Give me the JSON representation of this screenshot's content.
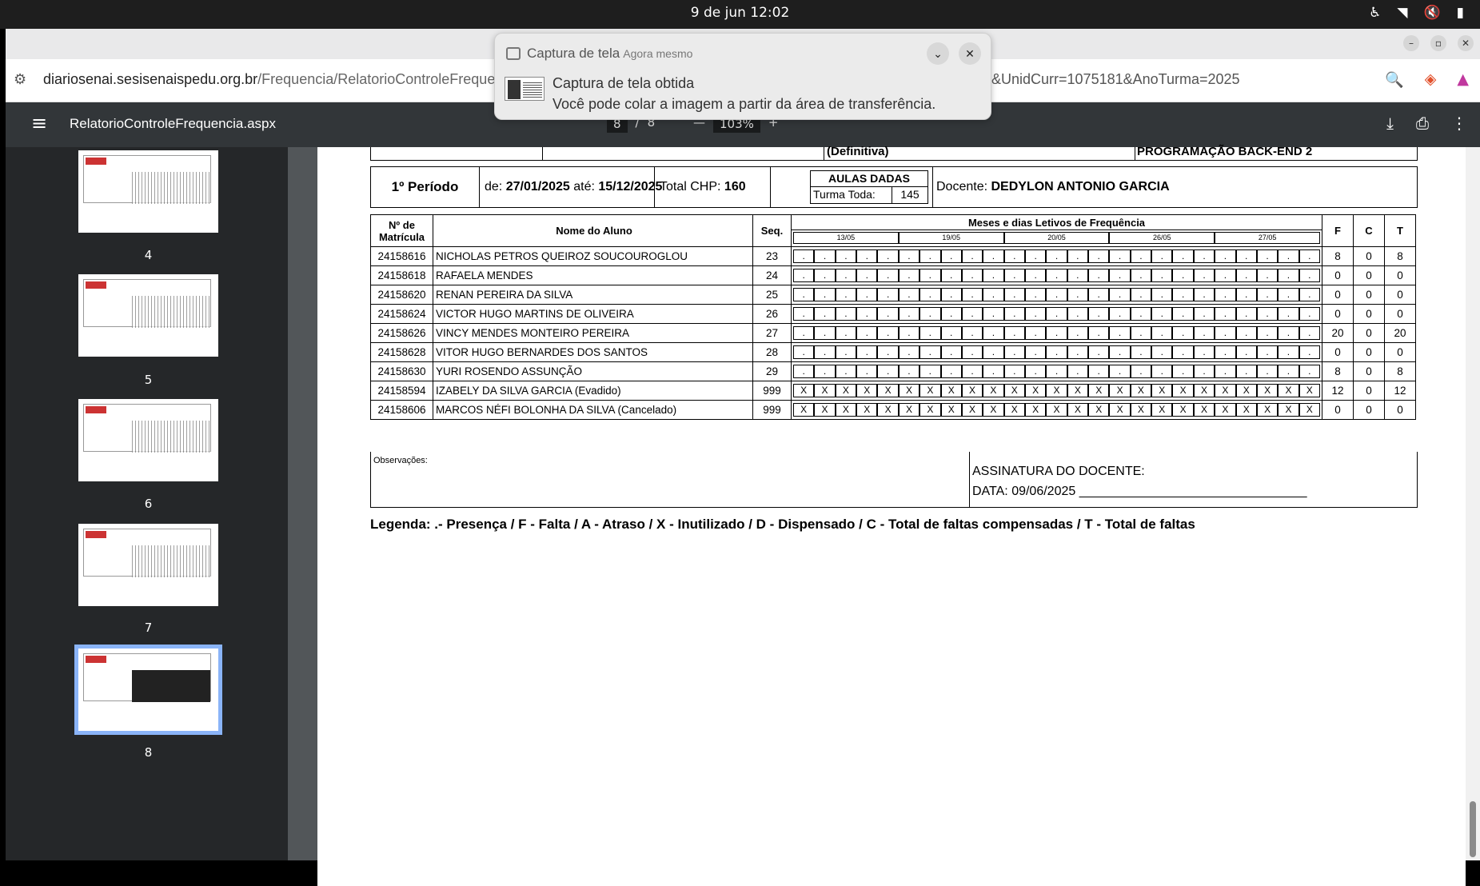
{
  "system": {
    "clock": "9 de jun  12:02"
  },
  "browser": {
    "url_host": "diariosenai.sesisenaispedu.org.br",
    "url_path": "/Frequencia/RelatorioControleFrequen",
    "url_tail": "&UnidCurr=1075181&AnoTurma=2025"
  },
  "pdf": {
    "filename": "RelatorioControleFrequencia.aspx",
    "page_current": "8",
    "page_total": "8",
    "zoom": "103%",
    "thumbnails": [
      {
        "label": "4"
      },
      {
        "label": "5"
      },
      {
        "label": "6"
      },
      {
        "label": "7"
      },
      {
        "label": "8"
      }
    ]
  },
  "notification": {
    "app": "Captura de tela",
    "time": "Agora mesmo",
    "title": "Captura de tela obtida",
    "body": "Você pode colar a imagem a partir da área de transferência."
  },
  "report": {
    "prev_row": {
      "left": "(Definitiva)",
      "right": "PROGRAMAÇÃO BACK-END 2"
    },
    "period": {
      "label": "1º Período",
      "from_label": "de:",
      "from": "27/01/2025",
      "to_label": "até:",
      "to": "15/12/2025",
      "chp_label": "Total CHP:",
      "chp": "160",
      "aulas_title": "AULAS DADAS",
      "turma_label": "Turma Toda:",
      "turma_value": "145",
      "docente_label": "Docente:",
      "docente": "DEDYLON ANTONIO GARCIA"
    },
    "headers": {
      "matricula": "Nº de Matrícula",
      "nome": "Nome do Aluno",
      "seq": "Seq.",
      "meses": "Meses e dias Letivos de Frequência",
      "dates": [
        "13/05",
        "19/05",
        "20/05",
        "26/05",
        "27/05"
      ],
      "f": "F",
      "c": "C",
      "t": "T"
    },
    "students": [
      {
        "mat": "24158616",
        "name": "NICHOLAS PETROS QUEIROZ SOUCOUROGLOU",
        "seq": "23",
        "mark": ".",
        "f": "8",
        "c": "0",
        "t": "8"
      },
      {
        "mat": "24158618",
        "name": "RAFAELA MENDES",
        "seq": "24",
        "mark": ".",
        "f": "0",
        "c": "0",
        "t": "0"
      },
      {
        "mat": "24158620",
        "name": "RENAN PEREIRA DA SILVA",
        "seq": "25",
        "mark": ".",
        "f": "0",
        "c": "0",
        "t": "0"
      },
      {
        "mat": "24158624",
        "name": "VICTOR HUGO MARTINS DE OLIVEIRA",
        "seq": "26",
        "mark": ".",
        "f": "0",
        "c": "0",
        "t": "0"
      },
      {
        "mat": "24158626",
        "name": "VINCY MENDES MONTEIRO PEREIRA",
        "seq": "27",
        "mark": ".",
        "f": "20",
        "c": "0",
        "t": "20"
      },
      {
        "mat": "24158628",
        "name": "VITOR HUGO BERNARDES DOS SANTOS",
        "seq": "28",
        "mark": ".",
        "f": "0",
        "c": "0",
        "t": "0"
      },
      {
        "mat": "24158630",
        "name": "YURI ROSENDO ASSUNÇÃO",
        "seq": "29",
        "mark": ".",
        "f": "8",
        "c": "0",
        "t": "8"
      },
      {
        "mat": "24158594",
        "name": "IZABELY DA SILVA GARCIA (Evadido)",
        "seq": "999",
        "mark": "X",
        "f": "12",
        "c": "0",
        "t": "12"
      },
      {
        "mat": "24158606",
        "name": "MARCOS NÉFI BOLONHA DA SILVA (Cancelado)",
        "seq": "999",
        "mark": "X",
        "f": "0",
        "c": "0",
        "t": "0"
      }
    ],
    "observacoes": "Observações:",
    "assinatura": "ASSINATURA DO DOCENTE:",
    "data_line": "DATA: 09/06/2025  ________________________________",
    "legend": "Legenda: .- Presença / F - Falta / A - Atraso / X - Inutilizado / D - Dispensado / C - Total de faltas compensadas / T - Total de faltas"
  }
}
